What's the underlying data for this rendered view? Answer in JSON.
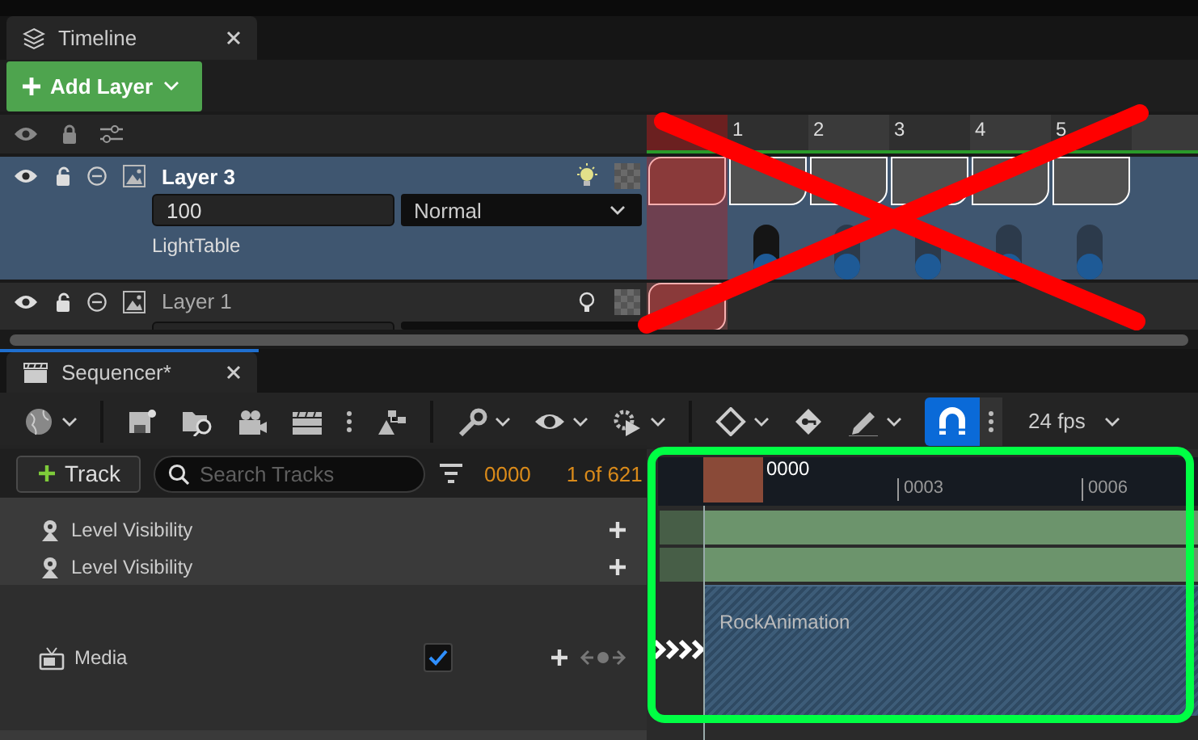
{
  "timeline_panel": {
    "tab": {
      "title": "Timeline"
    },
    "add_layer_button": {
      "label": "Add Layer"
    },
    "layers": [
      {
        "name": "Layer 3",
        "selected": true,
        "opacity": "100",
        "blend_mode": "Normal",
        "subtitle": "LightTable",
        "light_on": true
      },
      {
        "name": "Layer 1",
        "selected": false,
        "light_on": false
      }
    ],
    "frame_numbers": [
      "1",
      "2",
      "3",
      "4",
      "5"
    ]
  },
  "sequencer_panel": {
    "tab": {
      "title": "Sequencer*"
    },
    "snap_on": true,
    "frame_rate": "24 fps",
    "add_track_button": {
      "label": "Track"
    },
    "search": {
      "placeholder": "Search Tracks"
    },
    "current_frame": "0000",
    "frame_count": "1 of 621",
    "tracks": [
      {
        "name": "Level Visibility",
        "kind": "visibility"
      },
      {
        "name": "Level Visibility",
        "kind": "visibility"
      },
      {
        "name": "Media",
        "kind": "media",
        "checked": true
      }
    ],
    "ruler": {
      "playhead": "0000",
      "ticks": [
        "0003",
        "0006"
      ]
    },
    "clip": {
      "name": "RockAnimation"
    }
  },
  "annotations": [
    {
      "kind": "cross",
      "color": "#ff0000"
    },
    {
      "kind": "frame",
      "color": "#00ff44"
    }
  ]
}
